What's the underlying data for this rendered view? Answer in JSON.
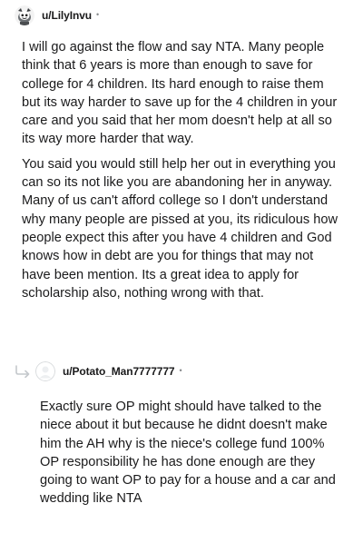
{
  "comments": [
    {
      "username": "u/LilyInvu",
      "separator": "•",
      "avatar_icon": "snoo-avatar-icon",
      "paragraphs": [
        "I will go against the flow and say NTA. Many people think that 6 years is more than enough to save for college for 4 children. Its hard enough to raise them but its way harder to save up for the 4 children in your care and you said that her mom doesn't help at all so its way more harder that way.",
        "You said you would still help her out in everything you can so its not like you are abandoning her in anyway. Many of us can't afford college so I don't understand why many people are pissed at you, its ridiculous how people expect this after you have 4 children and God knows how in debt are you for things that may not have been mention. Its a great idea to apply for scholarship also, nothing wrong with that."
      ]
    },
    {
      "username": "u/Potato_Man7777777",
      "separator": "•",
      "avatar_icon": "default-avatar-icon",
      "reply_icon": "reply-arrow-icon",
      "paragraphs": [
        "Exactly sure OP might should have talked to the niece about it but because he didnt doesn't make him the AH why is the niece's college fund 100% OP responsibility he has done enough are they going to want OP to pay for a house and a car and wedding like NTA"
      ]
    }
  ],
  "colors": {
    "text": "#1a1a1b",
    "meta": "#878a8c",
    "thread_line": "#c4c8cc",
    "default_avatar": "#d7dadc"
  }
}
